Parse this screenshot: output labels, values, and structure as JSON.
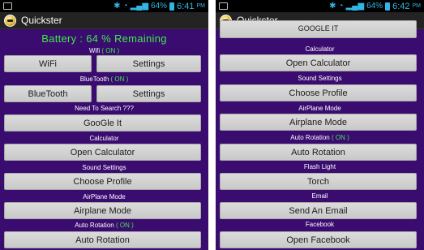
{
  "left": {
    "status": {
      "battery": "64%",
      "time": "6:41",
      "ampm": "PM"
    },
    "app_title": "Quickster",
    "battery_text": "Battery : 64 % Remaining",
    "wifi": {
      "label": "Wifi",
      "state": "( ON )",
      "toggle": "WiFi",
      "settings": "Settings"
    },
    "bluetooth": {
      "label": "BlueTooth",
      "state": "( ON )",
      "toggle": "BlueTooth",
      "settings": "Settings"
    },
    "search": {
      "label": "Need To Search ???",
      "button": "GooGle It"
    },
    "calculator": {
      "label": "Calculator",
      "button": "Open Calculator"
    },
    "sound": {
      "label": "Sound Settings",
      "button": "Choose Profile"
    },
    "airplane": {
      "label": "AirPlane Mode",
      "button": "Airplane Mode"
    },
    "rotation": {
      "label": "Auto Rotation",
      "state": "( ON )",
      "button": "Auto Rotation"
    }
  },
  "right": {
    "status": {
      "battery": "64%",
      "time": "6:42",
      "ampm": "PM"
    },
    "app_title": "Quickster",
    "partial_button": "GooGle It",
    "calculator": {
      "label": "Calculator",
      "button": "Open Calculator"
    },
    "sound": {
      "label": "Sound Settings",
      "button": "Choose Profile"
    },
    "airplane": {
      "label": "AirPlane Mode",
      "button": "Airplane Mode"
    },
    "rotation": {
      "label": "Auto Rotation",
      "state": "( ON )",
      "button": "Auto Rotation"
    },
    "flash": {
      "label": "Flash Light",
      "button": "Torch"
    },
    "email": {
      "label": "Email",
      "button": "Send An Email"
    },
    "facebook": {
      "label": "Facebook",
      "button": "Open Facebook"
    }
  },
  "colors": {
    "background": "#3a0c70",
    "accent_green": "#3fe84a",
    "button": "#d4d4d4",
    "statusbar_blue": "#33b5e5"
  }
}
